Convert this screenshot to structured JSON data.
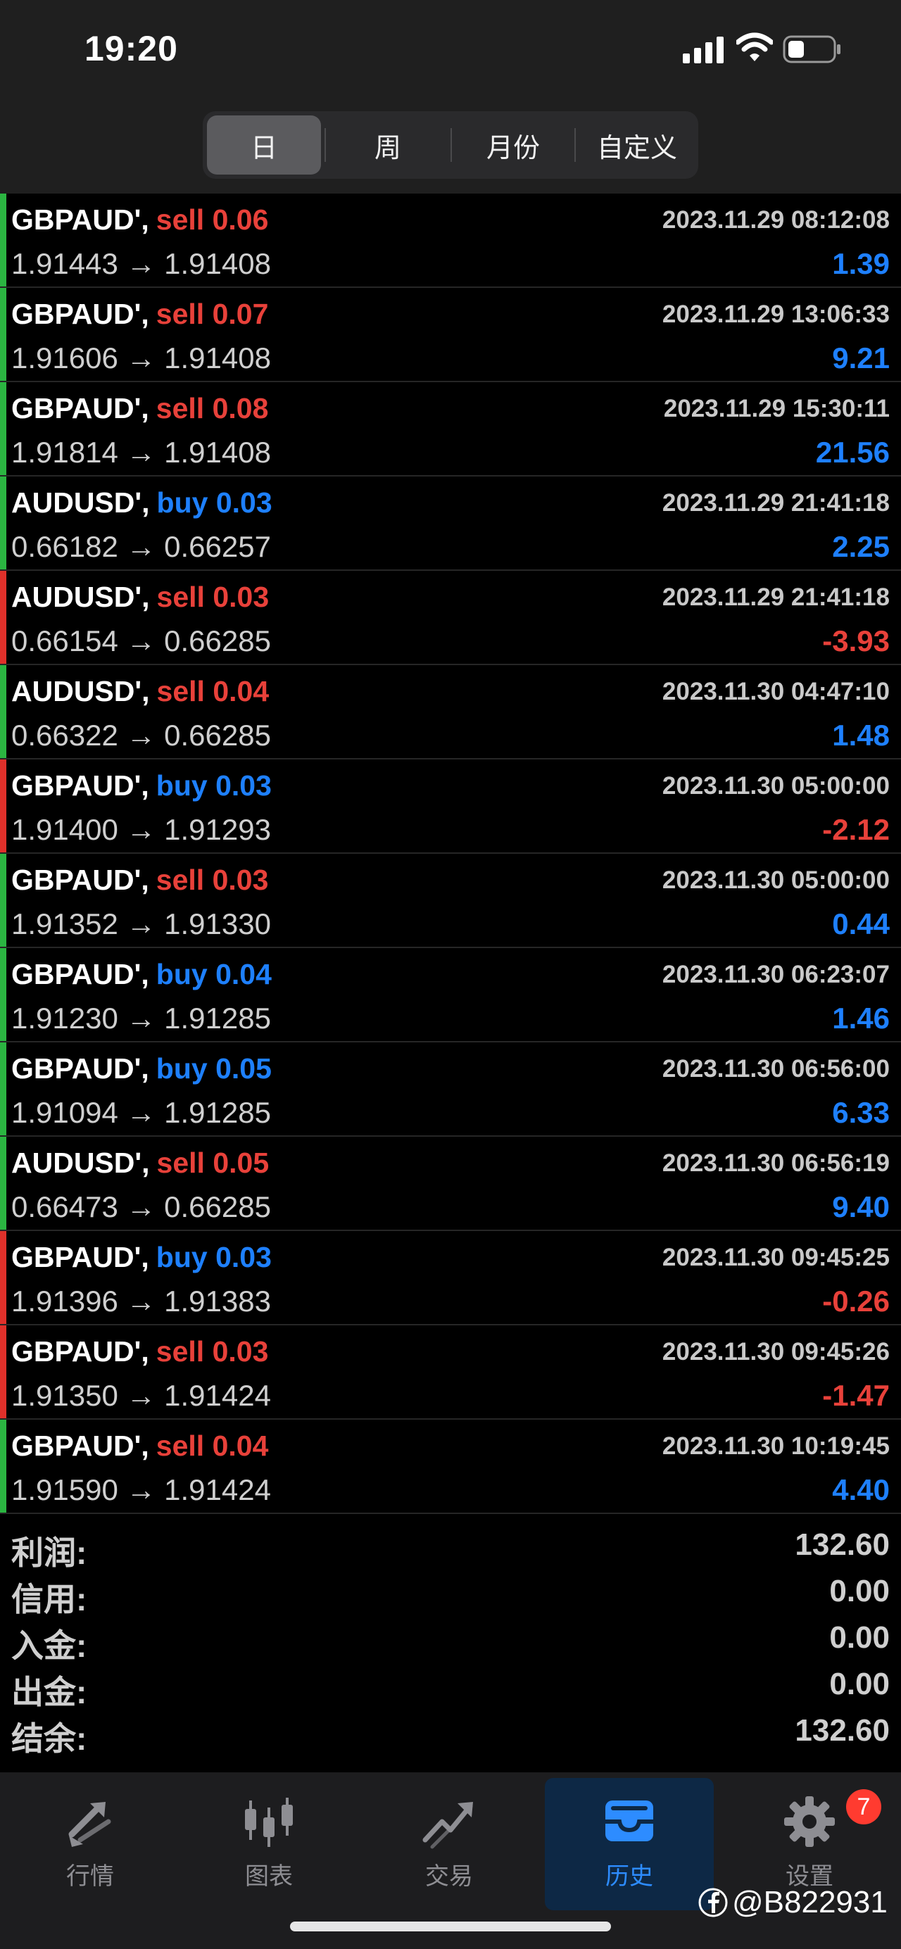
{
  "status_bar": {
    "time": "19:20"
  },
  "period_tabs": [
    {
      "label": "日",
      "active": true
    },
    {
      "label": "周",
      "active": false
    },
    {
      "label": "月份",
      "active": false
    },
    {
      "label": "自定义",
      "active": false
    }
  ],
  "trades": [
    {
      "symbol": "GBPAUD',",
      "side": "sell",
      "volume": "0.06",
      "time": "2023.11.29 08:12:08",
      "prices": "1.91443 → 1.91408",
      "profit": "1.39",
      "positive": true
    },
    {
      "symbol": "GBPAUD',",
      "side": "sell",
      "volume": "0.07",
      "time": "2023.11.29 13:06:33",
      "prices": "1.91606 → 1.91408",
      "profit": "9.21",
      "positive": true
    },
    {
      "symbol": "GBPAUD',",
      "side": "sell",
      "volume": "0.08",
      "time": "2023.11.29 15:30:11",
      "prices": "1.91814 → 1.91408",
      "profit": "21.56",
      "positive": true
    },
    {
      "symbol": "AUDUSD',",
      "side": "buy",
      "volume": "0.03",
      "time": "2023.11.29 21:41:18",
      "prices": "0.66182 → 0.66257",
      "profit": "2.25",
      "positive": true
    },
    {
      "symbol": "AUDUSD',",
      "side": "sell",
      "volume": "0.03",
      "time": "2023.11.29 21:41:18",
      "prices": "0.66154 → 0.66285",
      "profit": "-3.93",
      "positive": false
    },
    {
      "symbol": "AUDUSD',",
      "side": "sell",
      "volume": "0.04",
      "time": "2023.11.30 04:47:10",
      "prices": "0.66322 → 0.66285",
      "profit": "1.48",
      "positive": true
    },
    {
      "symbol": "GBPAUD',",
      "side": "buy",
      "volume": "0.03",
      "time": "2023.11.30 05:00:00",
      "prices": "1.91400 → 1.91293",
      "profit": "-2.12",
      "positive": false
    },
    {
      "symbol": "GBPAUD',",
      "side": "sell",
      "volume": "0.03",
      "time": "2023.11.30 05:00:00",
      "prices": "1.91352 → 1.91330",
      "profit": "0.44",
      "positive": true
    },
    {
      "symbol": "GBPAUD',",
      "side": "buy",
      "volume": "0.04",
      "time": "2023.11.30 06:23:07",
      "prices": "1.91230 → 1.91285",
      "profit": "1.46",
      "positive": true
    },
    {
      "symbol": "GBPAUD',",
      "side": "buy",
      "volume": "0.05",
      "time": "2023.11.30 06:56:00",
      "prices": "1.91094 → 1.91285",
      "profit": "6.33",
      "positive": true
    },
    {
      "symbol": "AUDUSD',",
      "side": "sell",
      "volume": "0.05",
      "time": "2023.11.30 06:56:19",
      "prices": "0.66473 → 0.66285",
      "profit": "9.40",
      "positive": true
    },
    {
      "symbol": "GBPAUD',",
      "side": "buy",
      "volume": "0.03",
      "time": "2023.11.30 09:45:25",
      "prices": "1.91396 → 1.91383",
      "profit": "-0.26",
      "positive": false
    },
    {
      "symbol": "GBPAUD',",
      "side": "sell",
      "volume": "0.03",
      "time": "2023.11.30 09:45:26",
      "prices": "1.91350 → 1.91424",
      "profit": "-1.47",
      "positive": false
    },
    {
      "symbol": "GBPAUD',",
      "side": "sell",
      "volume": "0.04",
      "time": "2023.11.30 10:19:45",
      "prices": "1.91590 → 1.91424",
      "profit": "4.40",
      "positive": true
    }
  ],
  "summary": [
    {
      "label": "利润:",
      "value": "132.60"
    },
    {
      "label": "信用:",
      "value": "0.00"
    },
    {
      "label": "入金:",
      "value": "0.00"
    },
    {
      "label": "出金:",
      "value": "0.00"
    },
    {
      "label": "结余:",
      "value": "132.60"
    }
  ],
  "tab_bar": [
    {
      "label": "行情",
      "icon": "quotes-arrows-icon",
      "active": false
    },
    {
      "label": "图表",
      "icon": "candlestick-chart-icon",
      "active": false
    },
    {
      "label": "交易",
      "icon": "trade-trend-icon",
      "active": false
    },
    {
      "label": "历史",
      "icon": "history-tray-icon",
      "active": true
    },
    {
      "label": "设置",
      "icon": "gear-icon",
      "active": false,
      "badge": "7"
    }
  ],
  "watermark": "@B822931",
  "colors": {
    "sell": "#e8413a",
    "buy": "#1e80ff",
    "profit_positive": "#1e80ff",
    "profit_negative": "#e8413a",
    "row_bar_positive": "#2bb541",
    "row_bar_negative": "#e0302a",
    "active_tab": "#2d8cff"
  }
}
